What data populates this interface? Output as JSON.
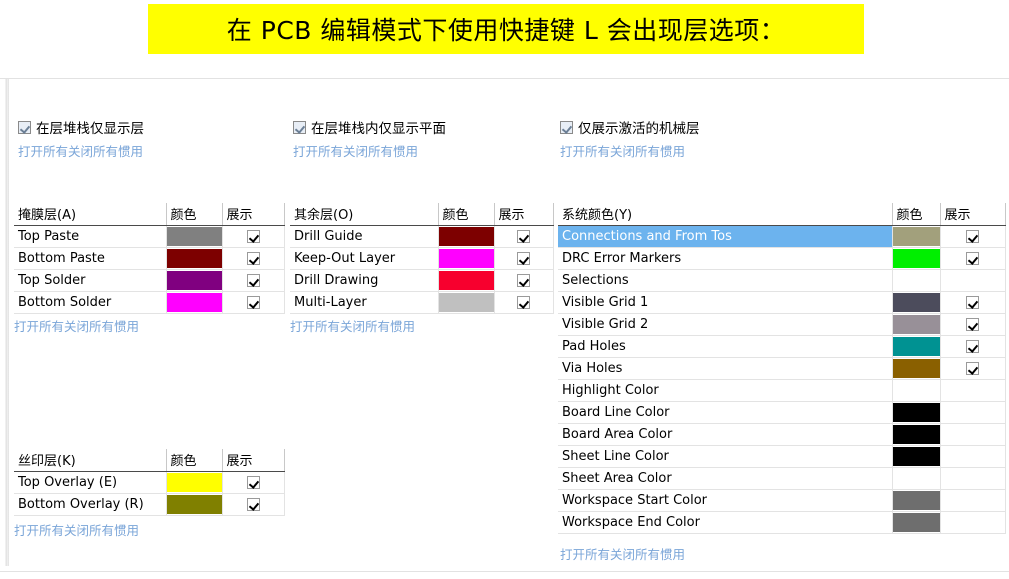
{
  "banner": {
    "text": "在 PCB 编辑模式下使用快捷键 L 会出现层选项："
  },
  "toggle_groups": [
    {
      "label": "在层堆栈仅显示层",
      "link": "打开所有关闭所有惯用",
      "checked": true
    },
    {
      "label": "在层堆栈内仅显示平面",
      "link": "打开所有关闭所有惯用",
      "checked": true
    },
    {
      "label": "仅展示激活的机械层",
      "link": "打开所有关闭所有惯用",
      "checked": true
    }
  ],
  "columns": {
    "color": "颜色",
    "show": "展示"
  },
  "tables": {
    "mask": {
      "title": "掩膜层(A)",
      "link": "打开所有关闭所有惯用",
      "rows": [
        {
          "name": "Top Paste",
          "color": "#808080",
          "show": true
        },
        {
          "name": "Bottom Paste",
          "color": "#7d0000",
          "show": true
        },
        {
          "name": "Top Solder",
          "color": "#800080",
          "show": true
        },
        {
          "name": "Bottom Solder",
          "color": "#ff00ff",
          "show": true
        }
      ]
    },
    "other": {
      "title": "其余层(O)",
      "link": "打开所有关闭所有惯用",
      "rows": [
        {
          "name": "Drill Guide",
          "color": "#7d0000",
          "show": true
        },
        {
          "name": "Keep-Out Layer",
          "color": "#ff00ff",
          "show": true
        },
        {
          "name": "Drill Drawing",
          "color": "#f7002e",
          "show": true
        },
        {
          "name": "Multi-Layer",
          "color": "#c0c0c0",
          "show": true
        }
      ]
    },
    "silkscreen": {
      "title": "丝印层(K)",
      "link": "打开所有关闭所有惯用",
      "rows": [
        {
          "name": "Top Overlay (E)",
          "color": "#ffff00",
          "show": true
        },
        {
          "name": "Bottom Overlay (R)",
          "color": "#808000",
          "show": true
        }
      ]
    },
    "system": {
      "title": "系统颜色(Y)",
      "link": "打开所有关闭所有惯用",
      "rows": [
        {
          "name": "Connections and From Tos",
          "color": "#a2a07c",
          "show": true,
          "selected": true
        },
        {
          "name": "DRC Error Markers",
          "color": "#00ef00",
          "show": true,
          "selected": false
        },
        {
          "name": "Selections",
          "color": "",
          "show": false,
          "selected": false
        },
        {
          "name": "Visible Grid 1",
          "color": "#4c4c5c",
          "show": true,
          "selected": false
        },
        {
          "name": "Visible Grid 2",
          "color": "#989098",
          "show": true,
          "selected": false
        },
        {
          "name": "Pad Holes",
          "color": "#009292",
          "show": true,
          "selected": false
        },
        {
          "name": "Via Holes",
          "color": "#8a6000",
          "show": true,
          "selected": false
        },
        {
          "name": "Highlight Color",
          "color": "",
          "show": false,
          "selected": false
        },
        {
          "name": "Board Line Color",
          "color": "#000000",
          "show": false,
          "selected": false
        },
        {
          "name": "Board Area Color",
          "color": "#000000",
          "show": false,
          "selected": false
        },
        {
          "name": "Sheet Line Color",
          "color": "#000000",
          "show": false,
          "selected": false
        },
        {
          "name": "Sheet Area Color",
          "color": "",
          "show": false,
          "selected": false
        },
        {
          "name": "Workspace Start Color",
          "color": "#6e6e6e",
          "show": false,
          "selected": false
        },
        {
          "name": "Workspace End Color",
          "color": "#6e6e6e",
          "show": false,
          "selected": false
        }
      ]
    }
  }
}
